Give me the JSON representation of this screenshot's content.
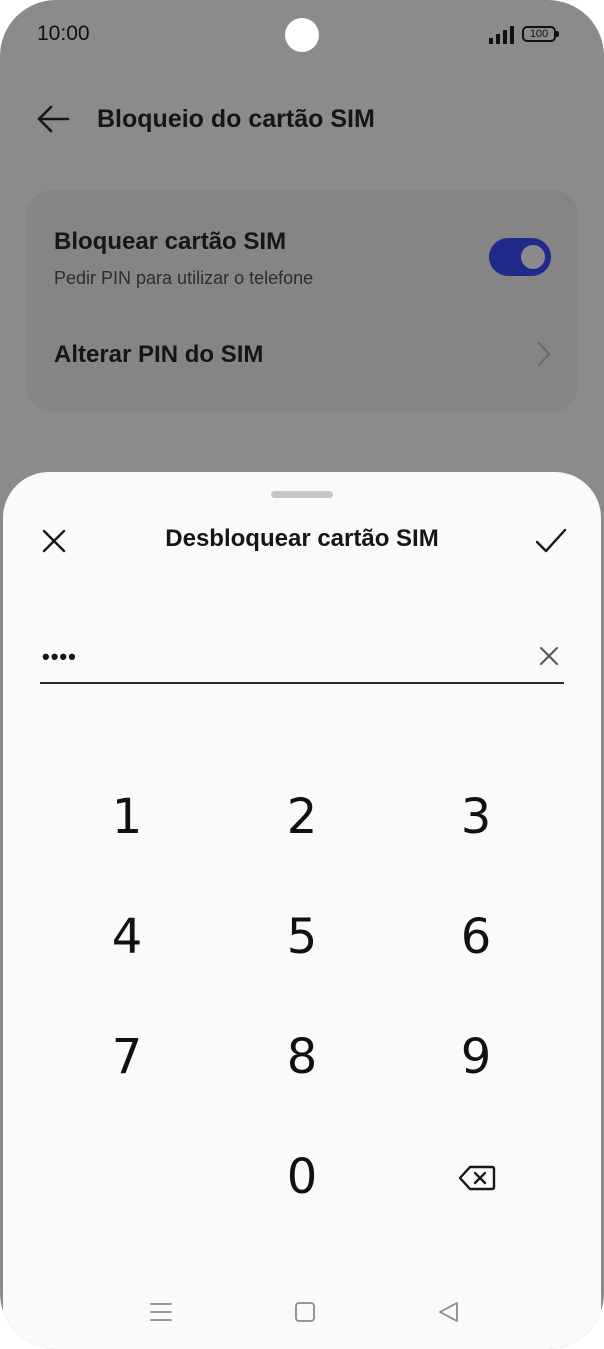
{
  "status_bar": {
    "time": "10:00",
    "battery": "100"
  },
  "header": {
    "title": "Bloqueio do cartão SIM"
  },
  "settings": {
    "lock_sim_title": "Bloquear cartão SIM",
    "lock_sim_subtitle": "Pedir PIN para utilizar o telefone",
    "lock_sim_enabled": true,
    "change_pin_label": "Alterar PIN do SIM"
  },
  "sheet": {
    "title": "Desbloquear cartão SIM",
    "pin_value": "••••"
  },
  "keypad": {
    "keys": [
      "1",
      "2",
      "3",
      "4",
      "5",
      "6",
      "7",
      "8",
      "9",
      "0"
    ]
  },
  "colors": {
    "toggle_on": "#1f2a8a",
    "sheet_background": "#fafafa",
    "dimmed_background": "#8b8b8b"
  },
  "icons": {
    "back": "arrow-left-icon",
    "close": "close-icon",
    "confirm": "check-icon",
    "clear": "clear-icon",
    "backspace": "backspace-icon",
    "chevron": "chevron-right-icon",
    "nav_recents": "menu-icon",
    "nav_home": "square-icon",
    "nav_back": "triangle-back-icon"
  }
}
